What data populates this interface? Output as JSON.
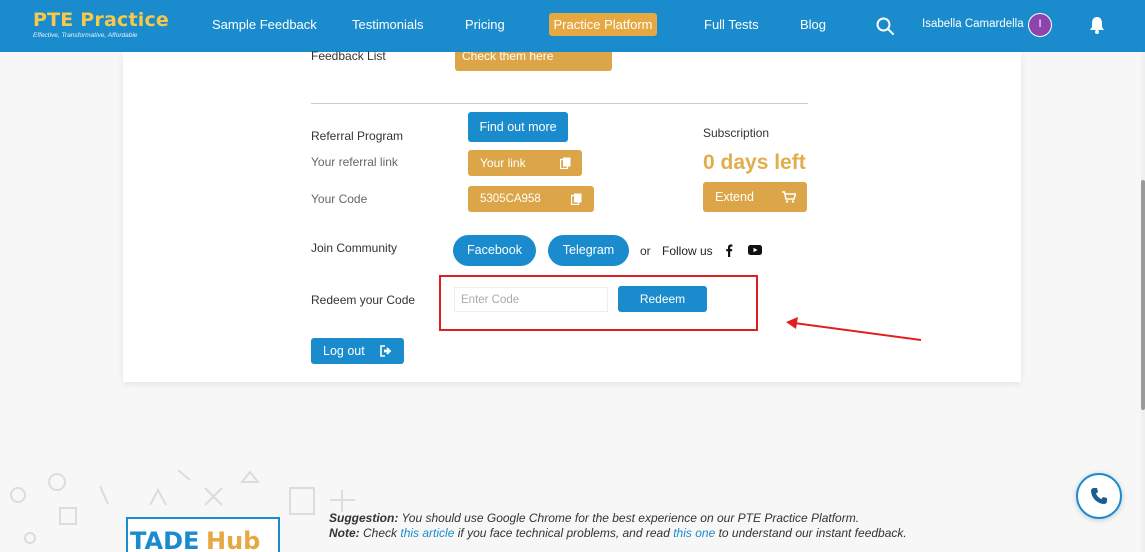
{
  "header": {
    "logo_title": "PTE Practice",
    "logo_tagline": "Effective, Transformative, Affordable",
    "nav": [
      "Sample Feedback",
      "Testimonials",
      "Pricing",
      "Practice Platform",
      "Full Tests",
      "Blog"
    ],
    "user_name": "Isabella Camardella",
    "avatar_initial": "I"
  },
  "account": {
    "feedback_label": "Feedback List",
    "feedback_button": "Check them here",
    "referral_label": "Referral Program",
    "find_out_more": "Find out more",
    "referral_link_label": "Your referral link",
    "your_link_button": "Your link",
    "code_label": "Your Code",
    "code_value": "5305CA958",
    "subscription_label": "Subscription",
    "days_left": "0 days left",
    "extend_button": "Extend",
    "community_label": "Join Community",
    "facebook_button": "Facebook",
    "telegram_button": "Telegram",
    "or_text": "or",
    "follow_text": "Follow us",
    "redeem_label": "Redeem your Code",
    "redeem_placeholder": "Enter Code",
    "redeem_button": "Redeem",
    "logout_button": "Log out"
  },
  "footer": {
    "brand_left": "TADE",
    "brand_right": "Hub",
    "suggestion_label": "Suggestion:",
    "suggestion_text": "You should use Google Chrome for the best experience on our PTE Practice Platform.",
    "note_label": "Note:",
    "note_pre": "Check",
    "note_link1": "this article",
    "note_mid": "if you face technical problems, and read",
    "note_link2": "this one",
    "note_post": "to understand our instant feedback."
  },
  "colors": {
    "brand_blue": "#1a8ccd",
    "brand_gold": "#dba548",
    "highlight_red": "#e02020"
  },
  "icons": [
    "search-icon",
    "bell-icon",
    "copy-icon",
    "cart-icon",
    "logout-icon",
    "facebook-icon",
    "youtube-icon",
    "phone-icon"
  ]
}
